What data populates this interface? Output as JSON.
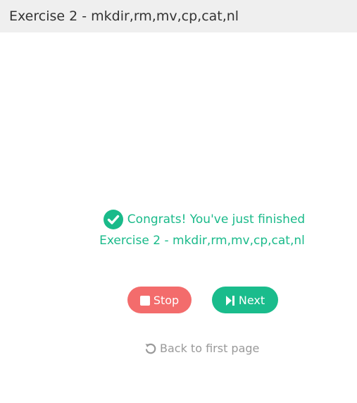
{
  "header": {
    "title": "Exercise 2 - mkdir,rm,mv,cp,cat,nl"
  },
  "message": {
    "line1": "Congrats! You've just finished",
    "line2": "Exercise 2 - mkdir,rm,mv,cp,cat,nl",
    "icon": "check-circle-icon",
    "color": "#1aba8a"
  },
  "buttons": {
    "stop": {
      "label": "Stop",
      "icon": "stop-icon",
      "color": "#f36c6c"
    },
    "next": {
      "label": "Next",
      "icon": "step-forward-icon",
      "color": "#1abc8c"
    }
  },
  "back_link": {
    "label": "Back to first page",
    "icon": "undo-icon",
    "color": "#999999"
  }
}
